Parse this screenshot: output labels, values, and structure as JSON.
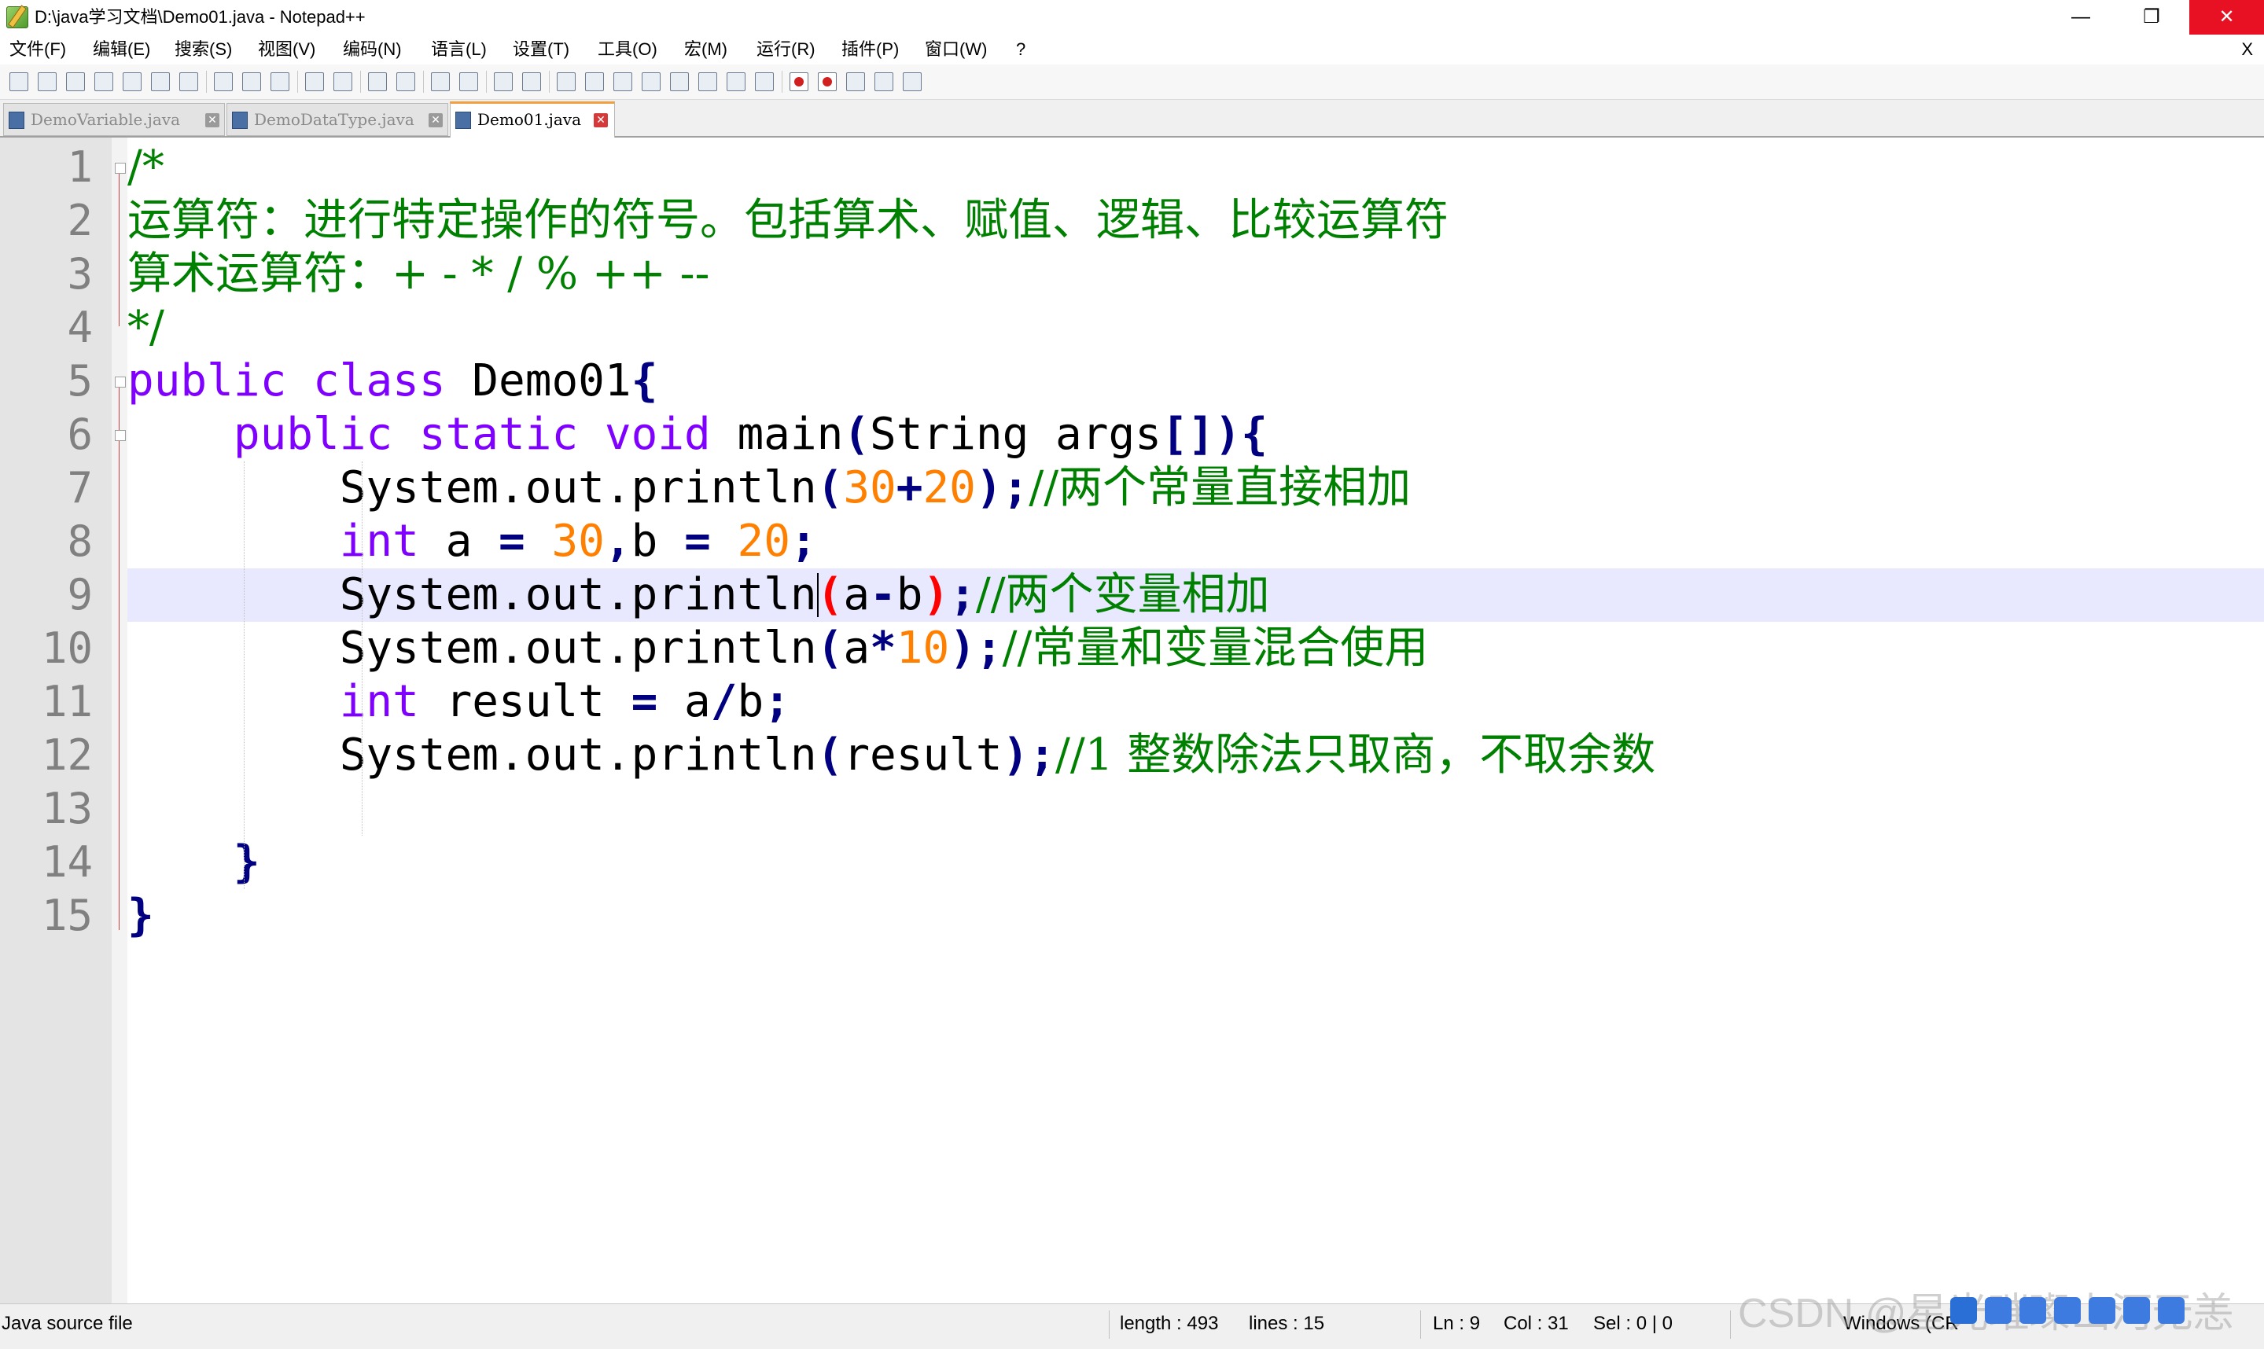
{
  "window": {
    "title": "D:\\java学习文档\\Demo01.java - Notepad++",
    "minimize": "—",
    "maximize": "❐",
    "close": "✕"
  },
  "menu": {
    "items": [
      "文件(F)",
      "编辑(E)",
      "搜索(S)",
      "视图(V)",
      "编码(N)",
      "语言(L)",
      "设置(T)",
      "工具(O)",
      "宏(M)",
      "运行(R)",
      "插件(P)",
      "窗口(W)",
      "?"
    ],
    "close": "X"
  },
  "toolbar": {
    "icons": [
      "new-file-icon",
      "open-file-icon",
      "save-icon",
      "save-all-icon",
      "close-icon",
      "close-all-icon",
      "print-icon",
      "cut-icon",
      "copy-icon",
      "paste-icon",
      "undo-icon",
      "redo-icon",
      "find-icon",
      "replace-icon",
      "zoom-in-icon",
      "zoom-out-icon",
      "sync-vertical-icon",
      "sync-horizontal-icon",
      "word-wrap-icon",
      "show-all-chars-icon",
      "indent-guide-icon",
      "language-icon",
      "doc-map-icon",
      "function-list-icon",
      "folder-as-workspace-icon",
      "monitoring-icon",
      "record-macro-icon",
      "stop-record-icon",
      "play-macro-icon",
      "run-macro-multiple-icon",
      "save-macro-icon"
    ]
  },
  "tabs": [
    {
      "label": "DemoVariable.java",
      "active": false
    },
    {
      "label": "DemoDataType.java",
      "active": false
    },
    {
      "label": "Demo01.java",
      "active": true
    }
  ],
  "editor": {
    "line_numbers": [
      "1",
      "2",
      "3",
      "4",
      "5",
      "6",
      "7",
      "8",
      "9",
      "10",
      "11",
      "12",
      "13",
      "14",
      "15"
    ],
    "current_line": 9,
    "lines": [
      [
        {
          "t": "/*",
          "c": "c"
        }
      ],
      [
        {
          "t": "运算符：进行特定操作的符号。包括算术、赋值、逻辑、比较运算符",
          "c": "c"
        }
      ],
      [
        {
          "t": "算术运算符：+ - * / % ++ --",
          "c": "c"
        }
      ],
      [
        {
          "t": "*/",
          "c": "c"
        }
      ],
      [
        {
          "t": "public",
          "c": "k"
        },
        {
          "t": " "
        },
        {
          "t": "class",
          "c": "k"
        },
        {
          "t": " Demo01"
        },
        {
          "t": "{",
          "c": "o"
        }
      ],
      [
        {
          "t": "\t"
        },
        {
          "t": "public",
          "c": "k"
        },
        {
          "t": " "
        },
        {
          "t": "static",
          "c": "k"
        },
        {
          "t": " "
        },
        {
          "t": "void",
          "c": "t"
        },
        {
          "t": " main"
        },
        {
          "t": "(",
          "c": "o"
        },
        {
          "t": "String args"
        },
        {
          "t": "[])",
          "c": "o"
        },
        {
          "t": "{",
          "c": "o"
        }
      ],
      [
        {
          "t": "\t\t"
        },
        {
          "t": "System.out.println"
        },
        {
          "t": "(",
          "c": "o"
        },
        {
          "t": "30",
          "c": "n"
        },
        {
          "t": "+",
          "c": "o"
        },
        {
          "t": "20",
          "c": "n"
        },
        {
          "t": ");",
          "c": "o"
        },
        {
          "t": "//两个常量直接相加",
          "c": "c"
        }
      ],
      [
        {
          "t": "\t\t"
        },
        {
          "t": "int",
          "c": "t"
        },
        {
          "t": " a "
        },
        {
          "t": "=",
          "c": "o"
        },
        {
          "t": " "
        },
        {
          "t": "30",
          "c": "n"
        },
        {
          "t": ",",
          "c": "o"
        },
        {
          "t": "b "
        },
        {
          "t": "=",
          "c": "o"
        },
        {
          "t": " "
        },
        {
          "t": "20",
          "c": "n"
        },
        {
          "t": ";",
          "c": "o"
        }
      ],
      [
        {
          "t": "\t\t"
        },
        {
          "t": "System.out.println"
        },
        {
          "t": "(",
          "c": "br-hl"
        },
        {
          "t": "a"
        },
        {
          "t": "-",
          "c": "o"
        },
        {
          "t": "b"
        },
        {
          "t": ")",
          "c": "br-hl"
        },
        {
          "t": ";",
          "c": "o"
        },
        {
          "t": "//两个变量相加",
          "c": "c"
        }
      ],
      [
        {
          "t": "\t\t"
        },
        {
          "t": "System.out.println"
        },
        {
          "t": "(",
          "c": "o"
        },
        {
          "t": "a"
        },
        {
          "t": "*",
          "c": "o"
        },
        {
          "t": "10",
          "c": "n"
        },
        {
          "t": ");",
          "c": "o"
        },
        {
          "t": "//常量和变量混合使用",
          "c": "c"
        }
      ],
      [
        {
          "t": "\t\t"
        },
        {
          "t": "int",
          "c": "t"
        },
        {
          "t": " result "
        },
        {
          "t": "=",
          "c": "o"
        },
        {
          "t": " a"
        },
        {
          "t": "/",
          "c": "o"
        },
        {
          "t": "b"
        },
        {
          "t": ";",
          "c": "o"
        }
      ],
      [
        {
          "t": "\t\t"
        },
        {
          "t": "System.out.println"
        },
        {
          "t": "(",
          "c": "o"
        },
        {
          "t": "result"
        },
        {
          "t": ");",
          "c": "o"
        },
        {
          "t": "//1 整数除法只取商，不取余数",
          "c": "c"
        }
      ],
      [
        {
          "t": "\t\t"
        }
      ],
      [
        {
          "t": "\t"
        },
        {
          "t": "}",
          "c": "o"
        }
      ],
      [
        {
          "t": "}",
          "c": "o"
        }
      ]
    ]
  },
  "status": {
    "file_type": "Java source file",
    "length": "length : 493",
    "lines": "lines : 15",
    "ln": "Ln : 9",
    "col": "Col : 31",
    "sel": "Sel : 0 | 0",
    "eol": "Windows (CR",
    "watermark": "CSDN @星光璀璨山河无恙"
  },
  "colors": {
    "keyword": "#8000ff",
    "comment": "#008000",
    "number": "#ff8000",
    "operator": "#000080",
    "current_line": "#e8e8ff",
    "close_button": "#e81123"
  }
}
